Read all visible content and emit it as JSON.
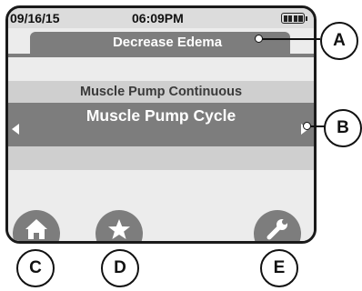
{
  "status": {
    "date": "09/16/15",
    "time": "06:09PM"
  },
  "header": {
    "title": "Decrease Edema"
  },
  "program_list": {
    "previous": "Muscle Pump Continuous",
    "selected": "Muscle Pump Cycle"
  },
  "callouts": {
    "a": "A",
    "b": "B",
    "c": "C",
    "d": "D",
    "e": "E"
  },
  "icons": {
    "battery": "battery-icon",
    "prev": "arrow-left-icon",
    "next": "arrow-right-icon",
    "home": "home-icon",
    "favorites": "star-icon",
    "settings": "wrench-icon"
  },
  "colors": {
    "panel_gray": "#7d7d7d",
    "band_gray": "#cfcfcf",
    "background": "#ececec",
    "text_white": "#ffffff"
  }
}
